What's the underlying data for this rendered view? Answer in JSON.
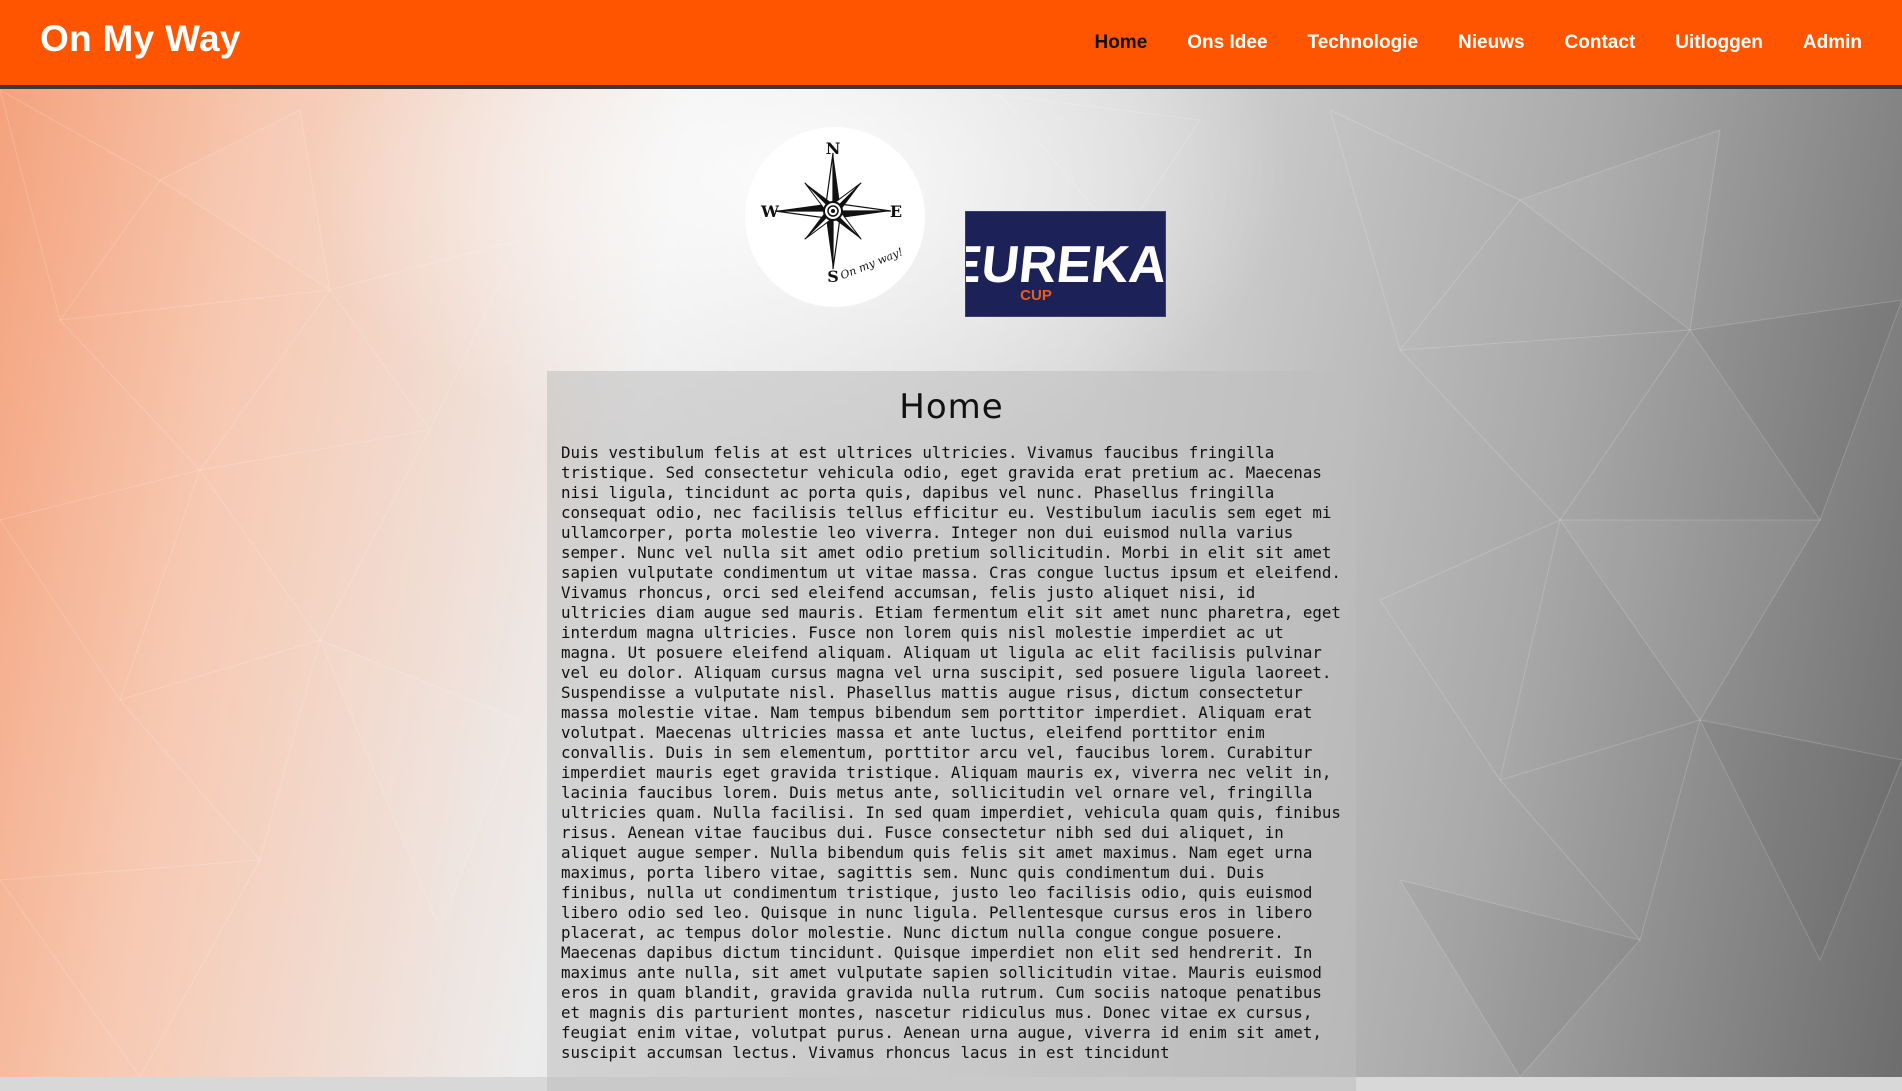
{
  "header": {
    "brand": "On My Way",
    "nav": [
      {
        "label": "Home",
        "active": true
      },
      {
        "label": "Ons Idee",
        "active": false
      },
      {
        "label": "Technologie",
        "active": false
      },
      {
        "label": "Nieuws",
        "active": false
      },
      {
        "label": "Contact",
        "active": false
      },
      {
        "label": "Uitloggen",
        "active": false
      },
      {
        "label": "Admin",
        "active": false
      }
    ]
  },
  "logos": {
    "compass": {
      "n": "N",
      "e": "E",
      "s": "S",
      "w": "W",
      "tagline": "On my way!"
    },
    "eureka": {
      "text": "EUREKA!",
      "sub": "CUP"
    }
  },
  "main": {
    "title": "Home",
    "body": "Duis vestibulum felis at est ultrices ultricies. Vivamus faucibus fringilla tristique. Sed consectetur vehicula odio, eget gravida erat pretium ac. Maecenas nisi ligula, tincidunt ac porta quis, dapibus vel nunc. Phasellus fringilla consequat odio, nec facilisis tellus efficitur eu. Vestibulum iaculis sem eget mi ullamcorper, porta molestie leo viverra. Integer non dui euismod nulla varius semper. Nunc vel nulla sit amet odio pretium sollicitudin. Morbi in elit sit amet sapien vulputate condimentum ut vitae massa. Cras congue luctus ipsum et eleifend. Vivamus rhoncus, orci sed eleifend accumsan, felis justo aliquet nisi, id ultricies diam augue sed mauris. Etiam fermentum elit sit amet nunc pharetra, eget interdum magna ultricies. Fusce non lorem quis nisl molestie imperdiet ac ut magna. Ut posuere eleifend aliquam. Aliquam ut ligula ac elit facilisis pulvinar vel eu dolor. Aliquam cursus magna vel urna suscipit, sed posuere ligula laoreet. Suspendisse a vulputate nisl. Phasellus mattis augue risus, dictum consectetur massa molestie vitae. Nam tempus bibendum sem porttitor imperdiet. Aliquam erat volutpat. Maecenas ultricies massa et ante luctus, eleifend porttitor enim convallis. Duis in sem elementum, porttitor arcu vel, faucibus lorem. Curabitur imperdiet mauris eget gravida tristique. Aliquam mauris ex, viverra nec velit in, lacinia faucibus lorem. Duis metus ante, sollicitudin vel ornare vel, fringilla ultricies quam. Nulla facilisi. In sed quam imperdiet, vehicula quam quis, finibus risus. Aenean vitae faucibus dui. Fusce consectetur nibh sed dui aliquet, in aliquet augue semper. Nulla bibendum quis felis sit amet maximus. Nam eget urna maximus, porta libero vitae, sagittis sem. Nunc quis condimentum dui. Duis finibus, nulla ut condimentum tristique, justo leo facilisis odio, quis euismod libero odio sed leo. Quisque in nunc ligula. Pellentesque cursus eros in libero placerat, ac tempus dolor molestie. Nunc dictum nulla congue congue posuere. Maecenas dapibus dictum tincidunt. Quisque imperdiet non elit sed hendrerit. In maximus ante nulla, sit amet vulputate sapien sollicitudin vitae. Mauris euismod eros in quam blandit, gravida gravida nulla rutrum. Cum sociis natoque penatibus et magnis dis parturient montes, nascetur ridiculus mus. Donec vitae ex cursus, feugiat enim vitae, volutpat purus. Aenean urna augue, viverra id enim sit amet, suscipit accumsan lectus. Vivamus rhoncus lacus in est tincidunt"
  },
  "colors": {
    "header_bg": "#ff5500",
    "header_border": "#3a3a3a",
    "nav_active": "#111111",
    "nav_text": "#ffffff",
    "eureka_bg": "#1c2257",
    "eureka_accent": "#f05a1a"
  }
}
